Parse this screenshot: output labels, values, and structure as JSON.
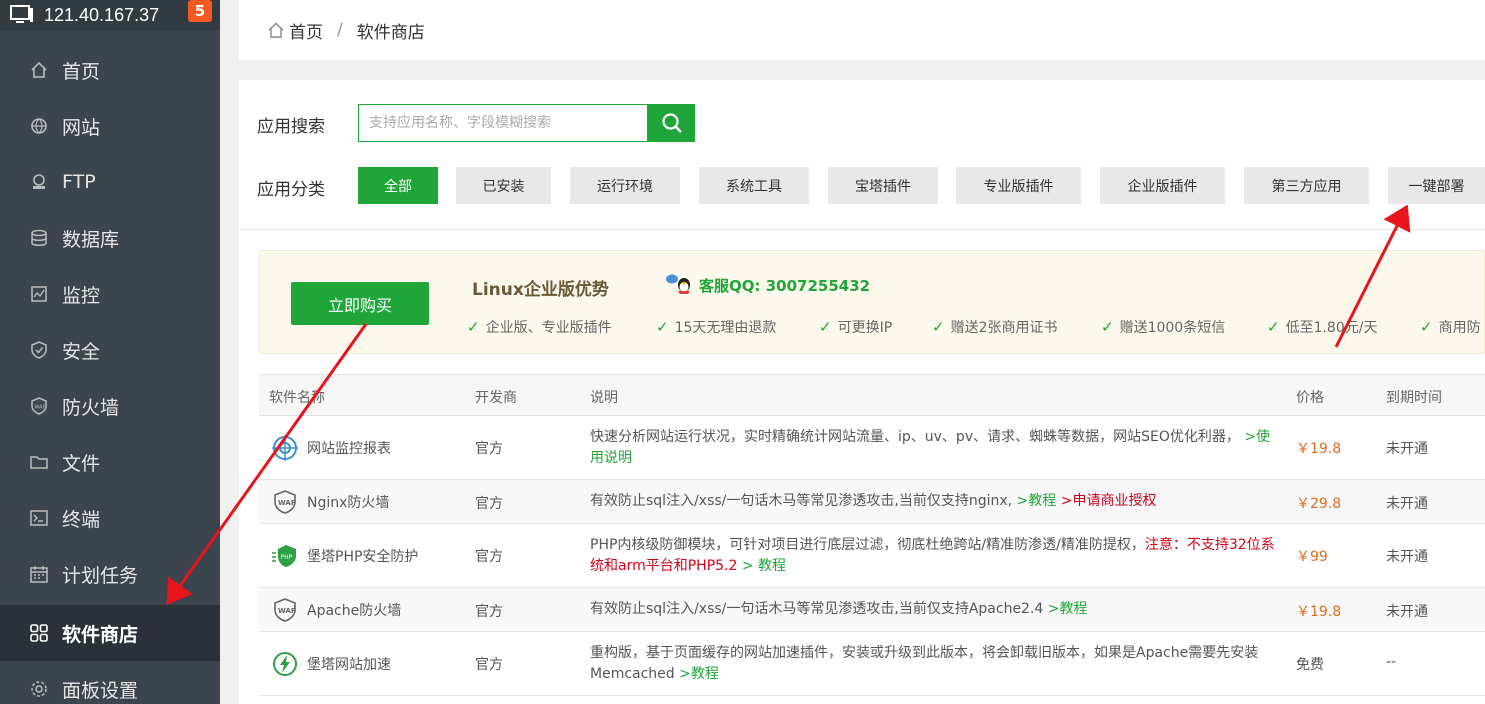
{
  "sidebar": {
    "ip": "121.40.167.37",
    "badge": "5",
    "items": [
      {
        "label": "首页",
        "icon": "home-icon"
      },
      {
        "label": "网站",
        "icon": "globe-icon"
      },
      {
        "label": "FTP",
        "icon": "ftp-icon"
      },
      {
        "label": "数据库",
        "icon": "database-icon"
      },
      {
        "label": "监控",
        "icon": "monitor-icon"
      },
      {
        "label": "安全",
        "icon": "shield-icon"
      },
      {
        "label": "防火墙",
        "icon": "firewall-icon"
      },
      {
        "label": "文件",
        "icon": "folder-icon"
      },
      {
        "label": "终端",
        "icon": "terminal-icon"
      },
      {
        "label": "计划任务",
        "icon": "calendar-icon"
      },
      {
        "label": "软件商店",
        "icon": "grid-icon",
        "active": true
      },
      {
        "label": "面板设置",
        "icon": "gear-icon"
      }
    ]
  },
  "breadcrumb": {
    "home": "首页",
    "separator": "/",
    "current": "软件商店"
  },
  "search": {
    "label": "应用搜索",
    "placeholder": "支持应用名称、字段模糊搜索"
  },
  "categories": {
    "label": "应用分类",
    "items": [
      "全部",
      "已安装",
      "运行环境",
      "系统工具",
      "宝塔插件",
      "专业版插件",
      "企业版插件",
      "第三方应用",
      "一键部署"
    ]
  },
  "promo": {
    "buy_label": "立即购买",
    "title": "Linux企业版优势",
    "qq_label": "客服QQ: 3007255432",
    "features": [
      "企业版、专业版插件",
      "15天无理由退款",
      "可更换IP",
      "赠送2张商用证书",
      "赠送1000条短信",
      "低至1.80元/天",
      "商用防"
    ]
  },
  "table": {
    "headers": [
      "软件名称",
      "开发商",
      "说明",
      "价格",
      "到期时间"
    ],
    "rows": [
      {
        "name": "网站监控报表",
        "dev": "官方",
        "desc": "快速分析网站运行状况，实时精确统计网站流量、ip、uv、pv、请求、蜘蛛等数据，网站SEO优化利器，",
        "link1": ">使用说明",
        "link2": "",
        "price": "￥19.8",
        "expire": "未开通",
        "icon": "web-monitor-icon"
      },
      {
        "name": "Nginx防火墙",
        "dev": "官方",
        "desc": "有效防止sql注入/xss/一句话木马等常见渗透攻击,当前仅支持nginx,",
        "link1": ">教程",
        "link2": ">申请商业授权",
        "price": "￥29.8",
        "expire": "未开通",
        "icon": "waf-icon"
      },
      {
        "name": "堡塔PHP安全防护",
        "dev": "官方",
        "desc": "PHP内核级防御模块，可针对项目进行底层过滤，彻底杜绝跨站/精准防渗透/精准防提权，",
        "warn": "注意：不支持32位系统和arm平台和PHP5.2",
        "link1": "> 教程",
        "link2": "",
        "price": "￥99",
        "expire": "未开通",
        "icon": "php-shield-icon"
      },
      {
        "name": "Apache防火墙",
        "dev": "官方",
        "desc": "有效防止sql注入/xss/一句话木马等常见渗透攻击,当前仅支持Apache2.4",
        "link1": ">教程",
        "link2": "",
        "price": "￥19.8",
        "expire": "未开通",
        "icon": "waf-icon"
      },
      {
        "name": "堡塔网站加速",
        "dev": "官方",
        "desc": "重构版，基于页面缓存的网站加速插件，安装或升级到此版本，将会卸载旧版本，如果是Apache需要先安装Memcached",
        "link1": ">教程",
        "link2": "",
        "price": "免费",
        "expire": "--",
        "icon": "speed-icon"
      }
    ]
  },
  "colors": {
    "accent": "#20a53a",
    "sidebar_bg": "#3c444d",
    "price": "#e06c22",
    "warn": "#d0021b",
    "annotation": "#e8141b"
  }
}
